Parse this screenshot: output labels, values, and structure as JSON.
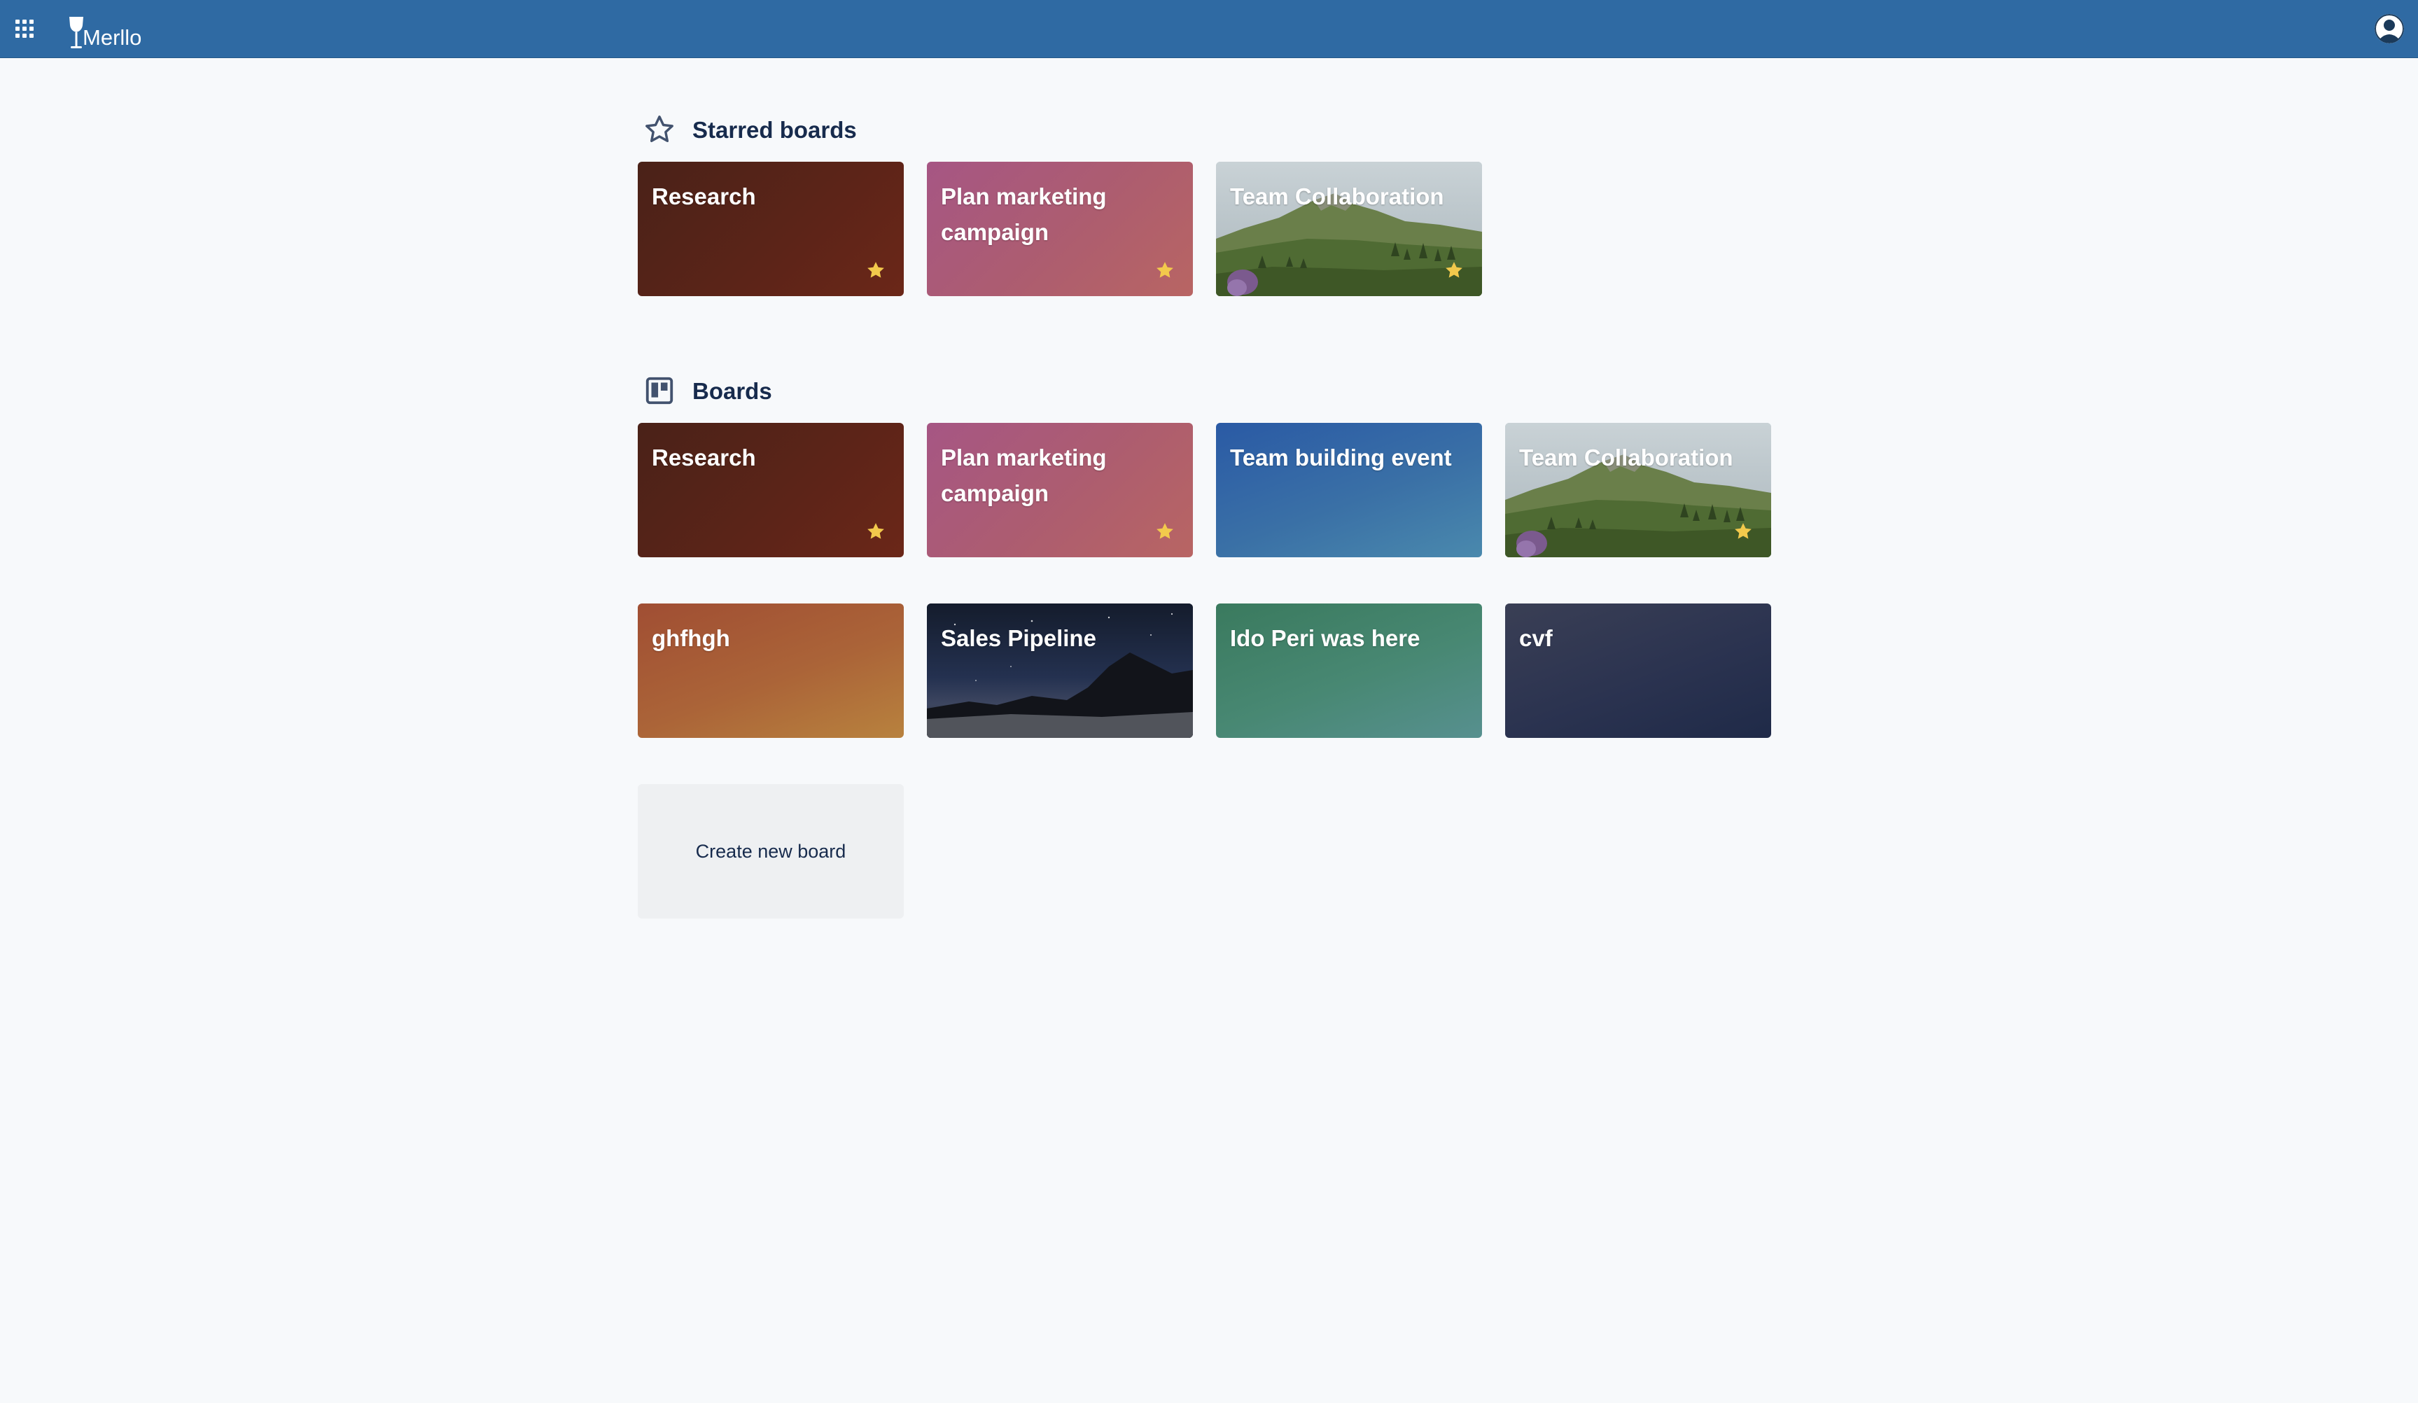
{
  "app": {
    "name": "Merllo",
    "brand_color": "#2f6aa3",
    "star_color": "#f2c94c"
  },
  "topbar": {
    "apps_icon": "apps-grid-icon",
    "logo_icon": "wine-glass-icon",
    "avatar_icon": "user-avatar-icon"
  },
  "starred": {
    "heading": "Starred boards",
    "icon": "star-outline-icon",
    "boards": [
      {
        "title": "Research",
        "background": "#5d2418",
        "starred": true
      },
      {
        "title": "Plan marketing campaign",
        "background": "#ad5d6f",
        "starred": true
      },
      {
        "title": "Team Collaboration",
        "background": "mountain-photo",
        "starred": true
      }
    ]
  },
  "boards": {
    "heading": "Boards",
    "icon": "board-icon",
    "items": [
      {
        "title": "Research",
        "background": "#5d2418",
        "starred": true
      },
      {
        "title": "Plan marketing campaign",
        "background": "#ad5d6f",
        "starred": true
      },
      {
        "title": "Team building event",
        "background": "#3a70a6",
        "starred": false
      },
      {
        "title": "Team Collaboration",
        "background": "mountain-photo",
        "starred": true
      },
      {
        "title": "ghfhgh",
        "background": "#ab6438",
        "starred": false
      },
      {
        "title": "Sales Pipeline",
        "background": "night-sky-photo",
        "starred": false
      },
      {
        "title": "Ido Peri was here",
        "background": "#488873",
        "starred": false
      },
      {
        "title": "cvf",
        "background": "#2b3350",
        "starred": false
      }
    ],
    "create_label": "Create new board"
  }
}
